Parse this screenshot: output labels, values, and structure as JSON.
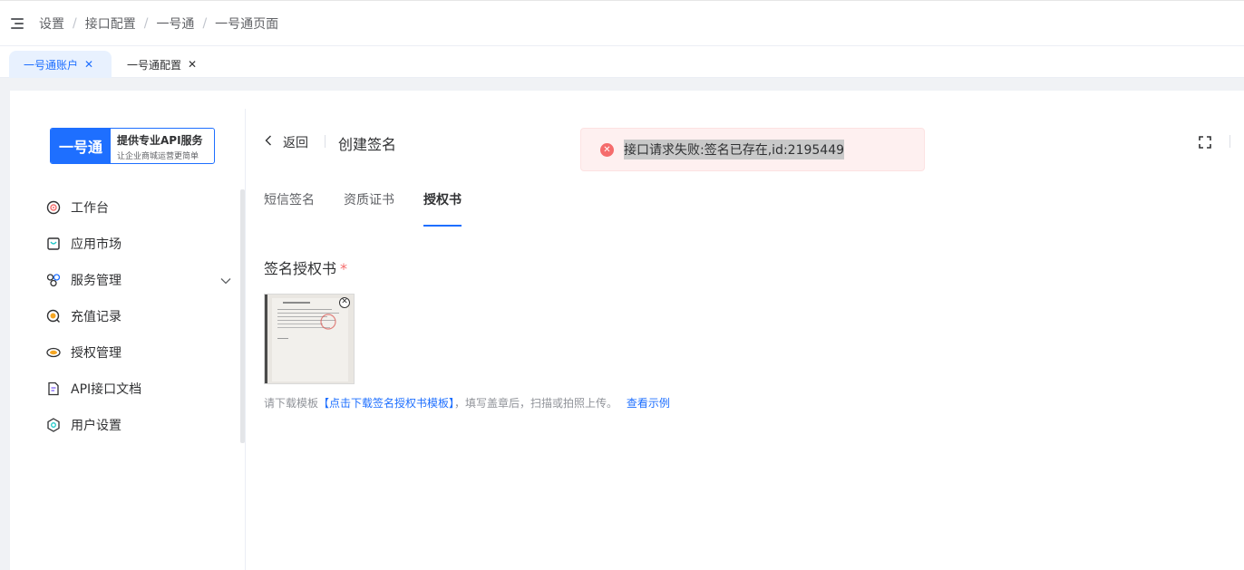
{
  "breadcrumb": [
    "设置",
    "接口配置",
    "一号通",
    "一号通页面"
  ],
  "tags": [
    {
      "label": "一号通账户",
      "active": true
    },
    {
      "label": "一号通配置",
      "active": false
    }
  ],
  "brand": {
    "logo": "一号通",
    "title": "提供专业API服务",
    "subtitle": "让企业商城运营更简单"
  },
  "sidebar": {
    "items": [
      {
        "label": "工作台",
        "icon": "target-icon"
      },
      {
        "label": "应用市场",
        "icon": "bag-icon"
      },
      {
        "label": "服务管理",
        "icon": "nodes-icon",
        "expandable": true
      },
      {
        "label": "充值记录",
        "icon": "coin-icon"
      },
      {
        "label": "授权管理",
        "icon": "key-icon"
      },
      {
        "label": "API接口文档",
        "icon": "doc-icon"
      },
      {
        "label": "用户设置",
        "icon": "settings-icon"
      }
    ]
  },
  "header": {
    "back_label": "返回",
    "title": "创建签名"
  },
  "tabs": [
    {
      "label": "短信签名",
      "active": false
    },
    {
      "label": "资质证书",
      "active": false
    },
    {
      "label": "授权书",
      "active": true
    }
  ],
  "form": {
    "label": "签名授权书",
    "required_mark": "*",
    "hint_prefix": "请下载模板",
    "hint_link": "【点击下载签名授权书模板】",
    "hint_middle": "，填写盖章后，扫描或拍照上传。",
    "hint_example": "查看示例"
  },
  "toast": {
    "type": "error",
    "message": "接口请求失败:签名已存在,id:2195449"
  },
  "colors": {
    "primary": "#1e6fff",
    "error": "#f56c6c",
    "tag_active_bg": "#e8f1fe"
  }
}
